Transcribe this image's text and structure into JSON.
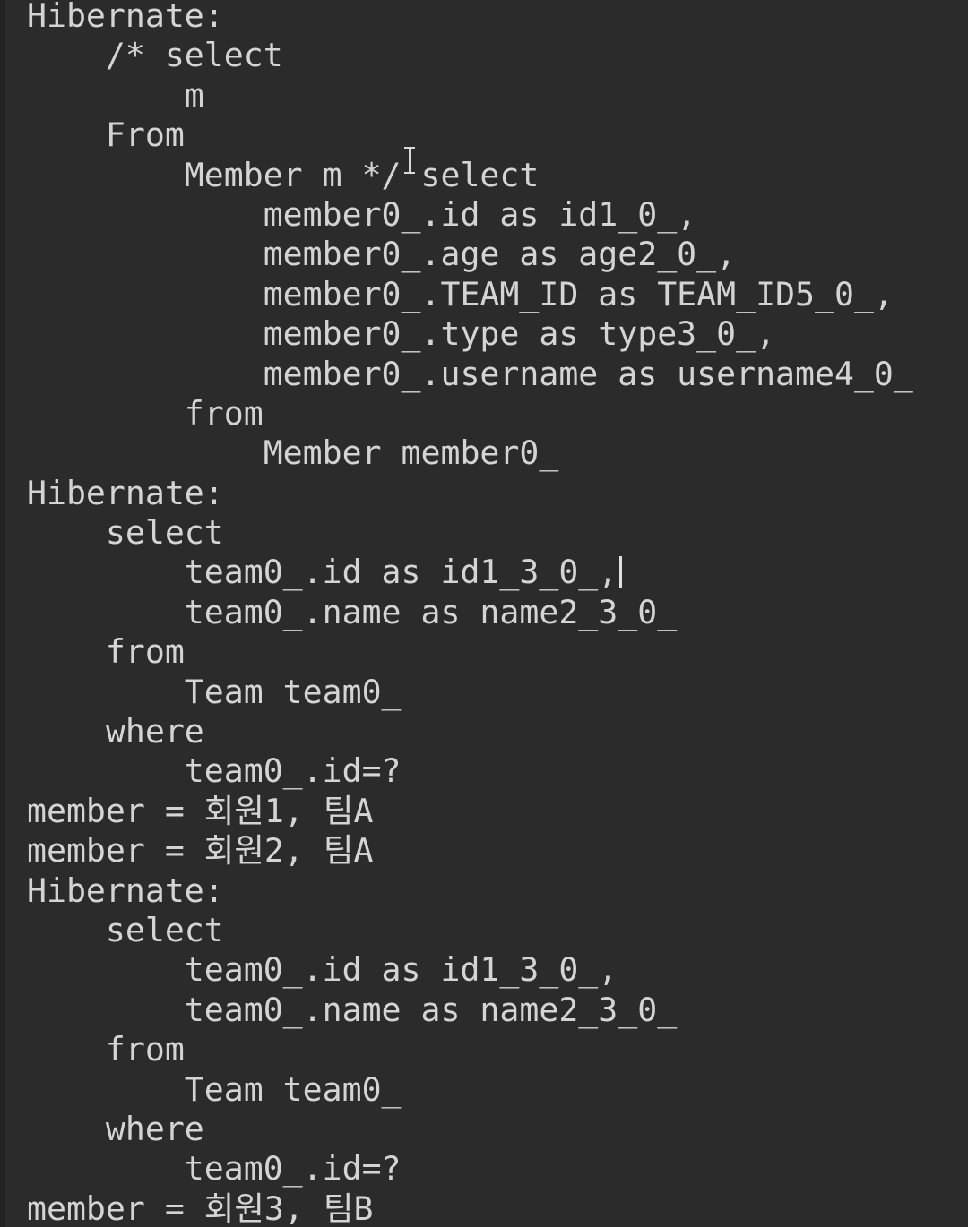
{
  "console": {
    "lines": [
      "Hibernate:",
      "    /* select",
      "        m",
      "    From",
      "        Member m */ select",
      "            member0_.id as id1_0_,",
      "            member0_.age as age2_0_,",
      "            member0_.TEAM_ID as TEAM_ID5_0_,",
      "            member0_.type as type3_0_,",
      "            member0_.username as username4_0_",
      "        from",
      "            Member member0_",
      "Hibernate:",
      "    select",
      "        team0_.id as id1_3_0_,",
      "        team0_.name as name2_3_0_",
      "    from",
      "        Team team0_",
      "    where",
      "        team0_.id=?",
      "member = 회원1, 팀A",
      "member = 회원2, 팀A",
      "Hibernate:",
      "    select",
      "        team0_.id as id1_3_0_,",
      "        team0_.name as name2_3_0_",
      "    from",
      "        Team team0_",
      "    where",
      "        team0_.id=?",
      "member = 회원3, 팀B"
    ]
  },
  "colors": {
    "background": "#2b2b2b",
    "text": "#d4d4d4"
  },
  "icons": {
    "mouse_cursor": "text-ibeam-cursor-icon",
    "text_caret": "text-caret-icon"
  }
}
